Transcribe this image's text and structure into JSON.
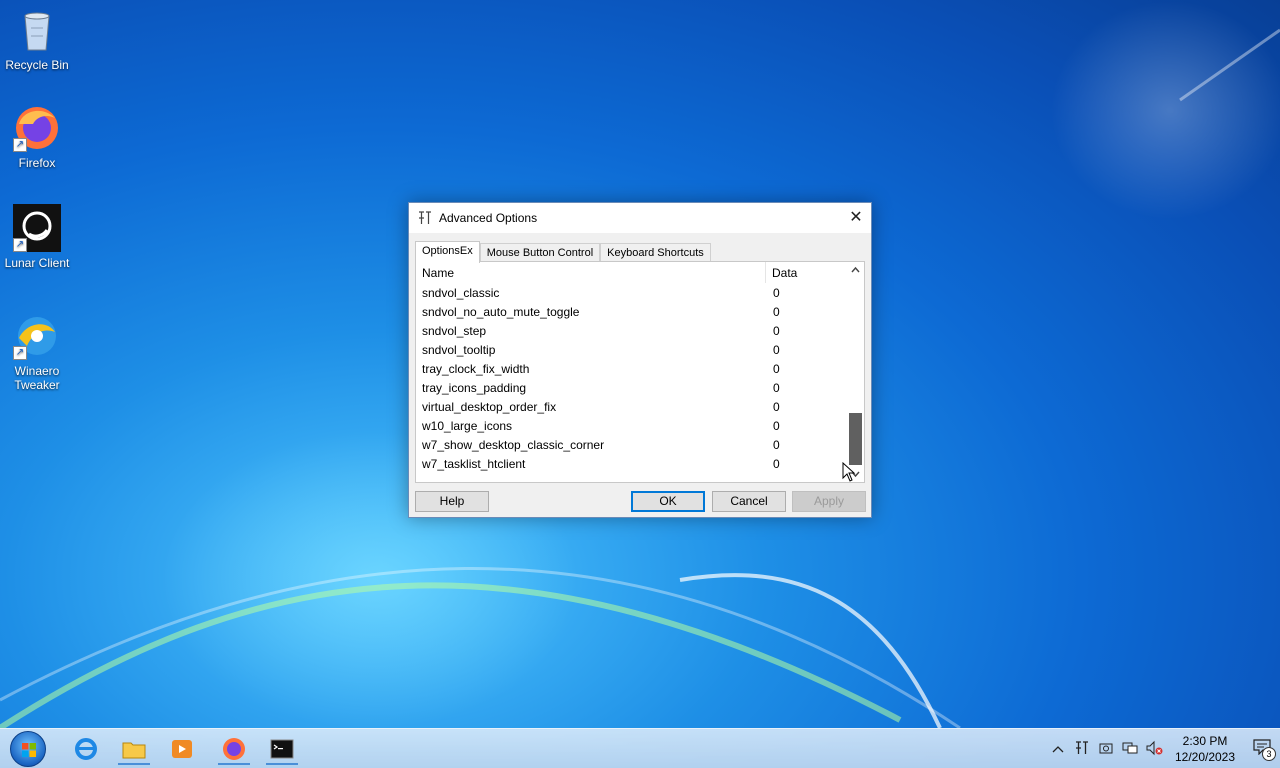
{
  "desktop": {
    "icons": [
      {
        "label": "Recycle Bin",
        "icon": "recycle-bin-icon"
      },
      {
        "label": "Firefox",
        "icon": "firefox-icon"
      },
      {
        "label": "Lunar Client",
        "icon": "lunar-client-icon"
      },
      {
        "label_line1": "Winaero",
        "label_line2": "Tweaker",
        "icon": "winaero-tweaker-icon"
      }
    ]
  },
  "dialog": {
    "title": "Advanced Options",
    "close_glyph": "✕",
    "tabs": [
      "OptionsEx",
      "Mouse Button Control",
      "Keyboard Shortcuts"
    ],
    "active_tab": "OptionsEx",
    "columns": {
      "name": "Name",
      "data": "Data"
    },
    "rows": [
      {
        "name": "sndvol_classic",
        "data": "0"
      },
      {
        "name": "sndvol_no_auto_mute_toggle",
        "data": "0"
      },
      {
        "name": "sndvol_step",
        "data": "0"
      },
      {
        "name": "sndvol_tooltip",
        "data": "0"
      },
      {
        "name": "tray_clock_fix_width",
        "data": "0"
      },
      {
        "name": "tray_icons_padding",
        "data": "0"
      },
      {
        "name": "virtual_desktop_order_fix",
        "data": "0"
      },
      {
        "name": "w10_large_icons",
        "data": "0"
      },
      {
        "name": "w7_show_desktop_classic_corner",
        "data": "0"
      },
      {
        "name": "w7_tasklist_htclient",
        "data": "0"
      }
    ],
    "buttons": {
      "help": "Help",
      "ok": "OK",
      "cancel": "Cancel",
      "apply": "Apply"
    }
  },
  "taskbar": {
    "pinned": [
      "internet-explorer-icon",
      "file-explorer-icon",
      "media-player-icon",
      "firefox-icon",
      "command-prompt-icon"
    ],
    "clock": {
      "time": "2:30 PM",
      "date": "12/20/2023"
    },
    "notifications_count": "3"
  },
  "colors": {
    "accent": "#0078d7",
    "scroll_thumb": "#606060"
  }
}
